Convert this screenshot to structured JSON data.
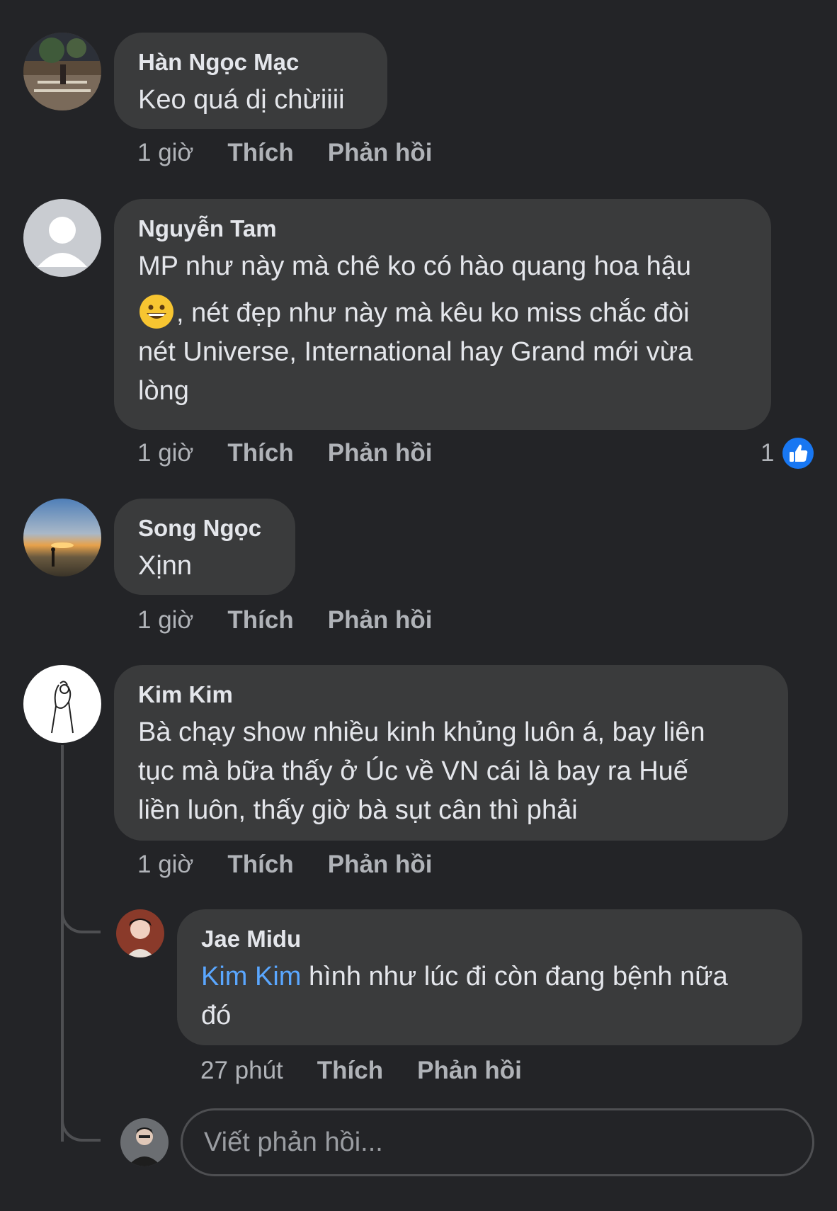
{
  "comments": [
    {
      "author": "Hàn Ngọc Mạc",
      "text": "Keo quá dị chừiiii",
      "time": "1 giờ",
      "like": "Thích",
      "reply": "Phản hồi"
    },
    {
      "author": "Nguyễn Tam",
      "text_line1": "MP như này mà chê ko có hào quang hoa hậu",
      "text_line2": ", nét đẹp như này mà kêu ko miss chắc đòi",
      "text_line3": "nét Universe, International hay Grand mới vừa",
      "text_line4": "lòng",
      "emoji": "grinning-face-emoji",
      "time": "1 giờ",
      "like": "Thích",
      "reply": "Phản hồi",
      "like_count": "1"
    },
    {
      "author": "Song Ngọc",
      "text": "Xịnn",
      "time": "1 giờ",
      "like": "Thích",
      "reply": "Phản hồi"
    },
    {
      "author": "Kim Kim",
      "text_line1": "Bà chạy show nhiều kinh khủng luôn á, bay liên",
      "text_line2": "tục mà bữa thấy ở Úc về VN cái là bay ra Huế",
      "text_line3": "liền luôn, thấy giờ bà sụt cân thì phải",
      "time": "1 giờ",
      "like": "Thích",
      "reply": "Phản hồi"
    }
  ],
  "reply": {
    "author": "Jae Midu",
    "mention": "Kim Kim",
    "text_line1": " hình như lúc đi còn đang bệnh nữa",
    "text_line2": "đó",
    "time": "27 phút",
    "like": "Thích",
    "reply": "Phản hồi"
  },
  "reply_input": {
    "placeholder": "Viết phản hồi..."
  },
  "colors": {
    "background": "#232427",
    "bubble": "#3a3b3c",
    "text": "#e4e6eb",
    "secondary": "#b0b3b8",
    "mention": "#5aa7ff",
    "like_badge": "#1877f2"
  }
}
